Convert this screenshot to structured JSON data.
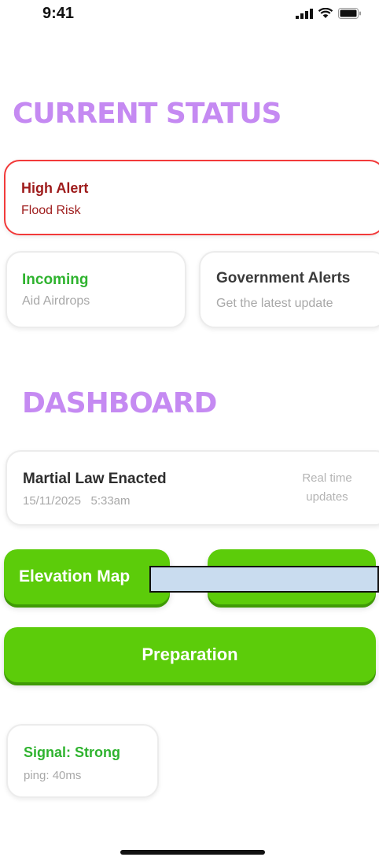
{
  "status_bar": {
    "time": "9:41"
  },
  "sections": {
    "current_status": "CURRENT STATUS",
    "dashboard": "DASHBOARD"
  },
  "alert": {
    "title": "High Alert",
    "subtitle": "Flood Risk"
  },
  "incoming": {
    "title": "Incoming",
    "subtitle": "Aid Airdrops"
  },
  "government": {
    "title": "Government Alerts",
    "subtitle": "Get the latest update"
  },
  "update": {
    "title": "Martial Law Enacted",
    "date": "15/11/2025",
    "time": "5:33am",
    "note": "Real time updates"
  },
  "buttons": {
    "elevation_map": "Elevation Map",
    "right_button": "",
    "preparation": "Preparation"
  },
  "signal": {
    "title": "Signal: Strong",
    "ping": "ping: 40ms"
  },
  "colors": {
    "heading": "#c58af2",
    "alert_border": "#f23a3a",
    "alert_text": "#9e1b1b",
    "success": "#2fb32f",
    "button": "#5ccc0a",
    "redaction": "#c9dcef"
  },
  "icons": [
    "signal-icon",
    "wifi-icon",
    "battery-icon"
  ]
}
